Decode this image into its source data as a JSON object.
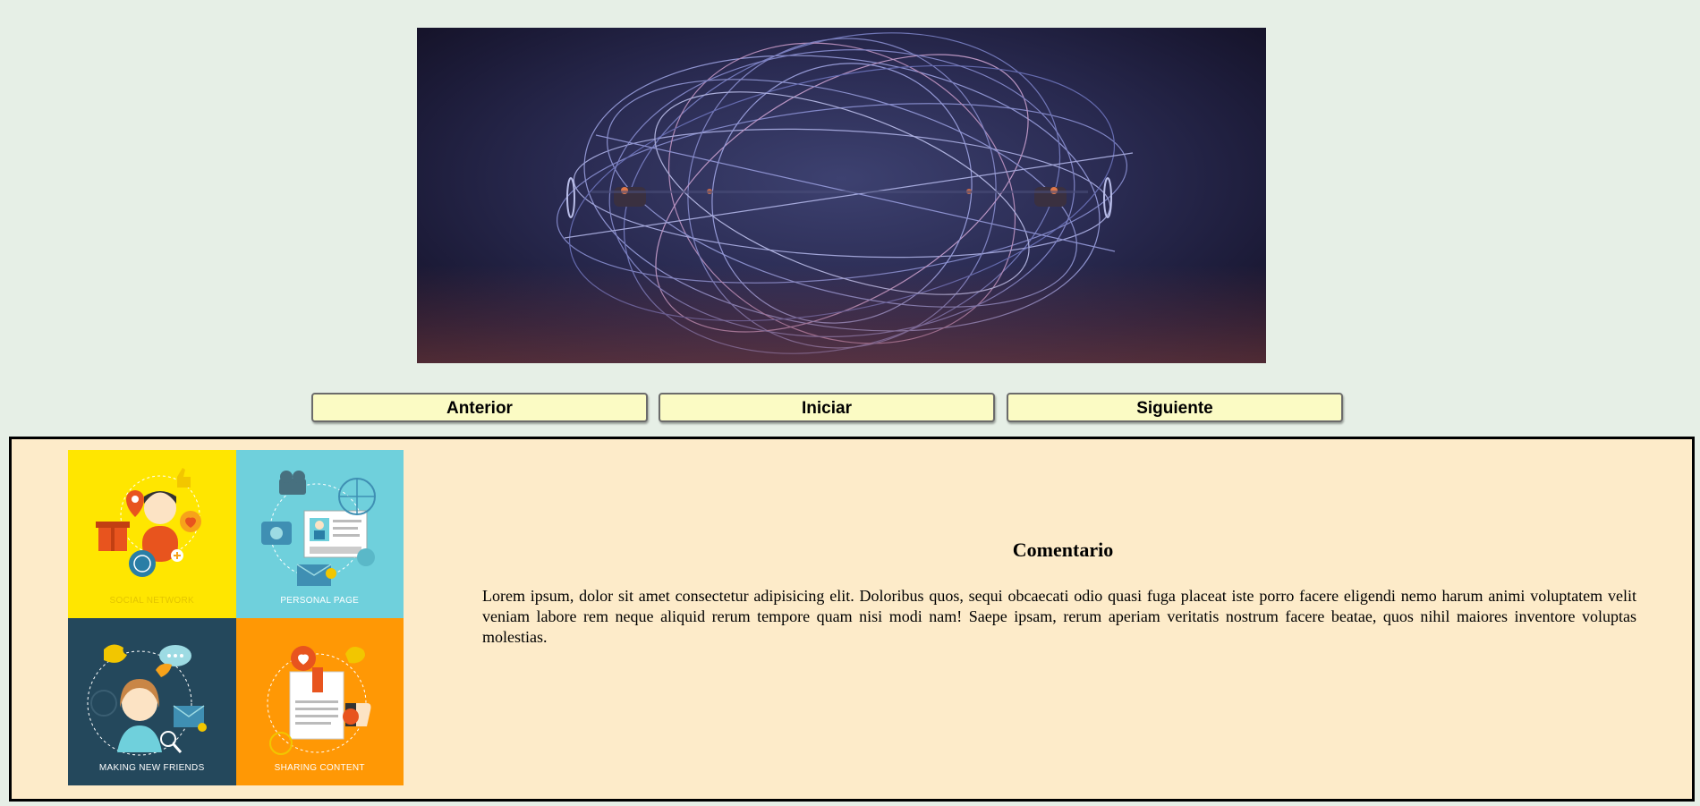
{
  "slideshow": {
    "buttons": {
      "previous": "Anterior",
      "start": "Iniciar",
      "next": "Siguiente"
    }
  },
  "content": {
    "tiles": [
      {
        "label": "SOCIAL NETWORK",
        "color": "#ffe600"
      },
      {
        "label": "PERSONAL PAGE",
        "color": "#6fd0dc"
      },
      {
        "label": "MAKING NEW FRIENDS",
        "color": "#24485c"
      },
      {
        "label": "SHARING CONTENT",
        "color": "#ff9805"
      }
    ],
    "title": "Comentario",
    "body": "Lorem ipsum, dolor sit amet consectetur adipisicing elit. Doloribus quos, sequi obcaecati odio quasi fuga placeat iste porro facere eligendi nemo harum animi voluptatem velit veniam labore rem neque aliquid rerum tempore quam nisi modi nam! Saepe ipsam, rerum aperiam veritatis nostrum facere beatae, quos nihil maiores inventore voluptas molestias."
  },
  "colors": {
    "page_background": "#e6efe6",
    "button_background": "#fbfbc4",
    "panel_background": "#fdebc9"
  }
}
